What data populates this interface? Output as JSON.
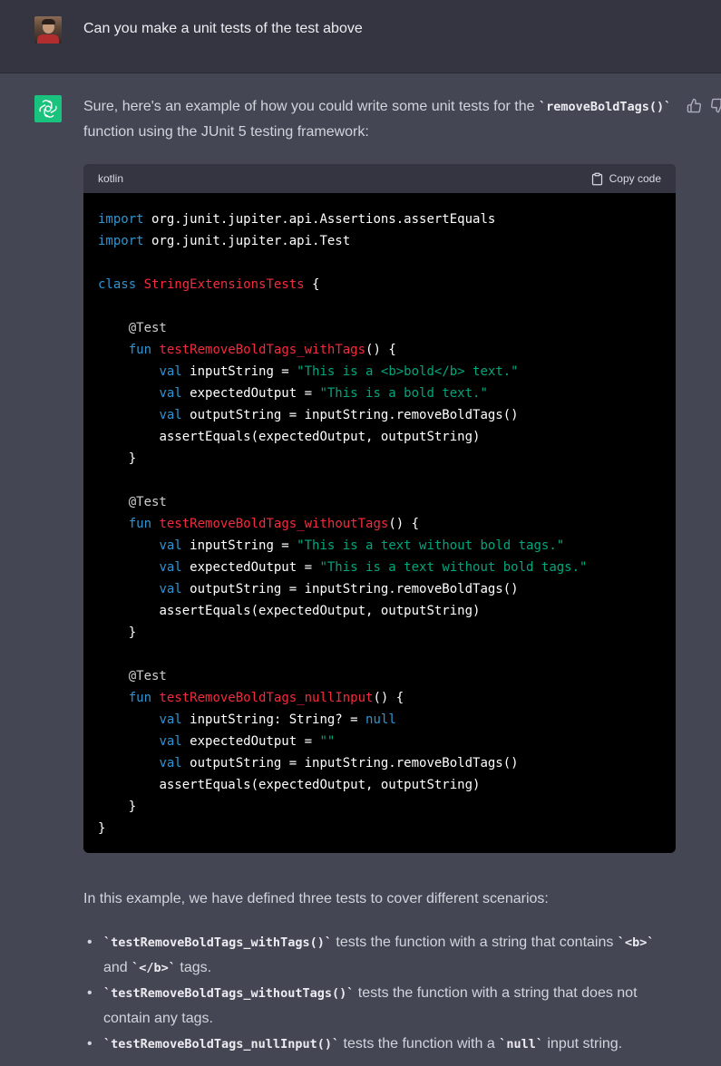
{
  "user": {
    "message": "Can you make a unit tests of the test above"
  },
  "assistant": {
    "intro": {
      "before": "Sure, here's an example of how you could write some unit tests for the ",
      "code": "`removeBoldTags()`",
      "after": " function using the JUnit 5 testing framework:"
    },
    "code_block": {
      "language": "kotlin",
      "copy_label": "Copy code"
    },
    "summary": "In this example, we have defined three tests to cover different scenarios:",
    "bullets": [
      {
        "code": "`testRemoveBoldTags_withTags()`",
        "text1": " tests the function with a string that contains ",
        "code2": "`<b>`",
        "text2": " and ",
        "code3": "`</b>`",
        "text3": " tags."
      },
      {
        "code": "`testRemoveBoldTags_withoutTags()`",
        "text1": " tests the function with a string that does not contain any tags."
      },
      {
        "code": "`testRemoveBoldTags_nullInput()`",
        "text1": " tests the function with a ",
        "code2": "`null`",
        "text2": " input string."
      }
    ]
  },
  "code": {
    "import_kw": "import",
    "import1": " org.junit.jupiter.api.Assertions.assertEquals",
    "import2": " org.junit.jupiter.api.Test",
    "class_kw": "class",
    "class_name": "StringExtensionsTests",
    "open_brace": " {",
    "annotation": "@Test",
    "fun_kw": "fun",
    "val_kw": "val",
    "t1_name": "testRemoveBoldTags_withTags",
    "t1_input": "\"This is a <b>bold</b> text.\"",
    "t1_expected": "\"This is a bold text.\"",
    "t2_name": "testRemoveBoldTags_withoutTags",
    "t2_input": "\"This is a text without bold tags.\"",
    "t2_expected": "\"This is a text without bold tags.\"",
    "t3_name": "testRemoveBoldTags_nullInput",
    "t3_null": "null",
    "t3_expected": "\"\"",
    "sig_suffix": "() {",
    "input_decl": " inputString = ",
    "input_decl_typed": " inputString: String? = ",
    "expected_decl": " expectedOutput = ",
    "output_line": " outputString = inputString.removeBoldTags()",
    "assert_line": "assertEquals(expectedOutput, outputString)",
    "close_brace": "}"
  },
  "colors": {
    "user_bg": "#343541",
    "assistant_bg": "#444654",
    "gpt_logo": "#19c37d",
    "keyword": "#2e95d3",
    "function_name": "#f22c3d",
    "string": "#00a67d"
  },
  "icons": [
    "user-avatar",
    "openai-logo-icon",
    "thumbs-up-icon",
    "thumbs-down-icon",
    "clipboard-icon"
  ]
}
